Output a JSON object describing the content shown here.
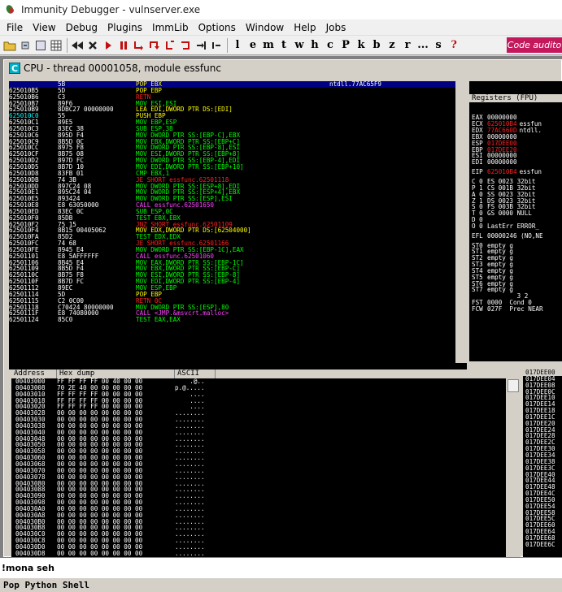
{
  "window": {
    "title": "Immunity Debugger - vulnserver.exe"
  },
  "menu": [
    "File",
    "View",
    "Debug",
    "Plugins",
    "ImmLib",
    "Options",
    "Window",
    "Help",
    "Jobs"
  ],
  "toolbar": {
    "letters": [
      "l",
      "e",
      "m",
      "t",
      "w",
      "h",
      "c",
      "P",
      "k",
      "b",
      "z",
      "r",
      "...",
      "s",
      "?"
    ],
    "code_auditor_label": "Code audito"
  },
  "cpu": {
    "caption": "CPU - thread 00001058, module essfunc",
    "icon_letter": "C",
    "disasm": [
      {
        "addr": "625010B4",
        "hex": "5B",
        "instr": "POP EBX",
        "color": "yellow",
        "cmt": "ntdll.77AC65F9",
        "sel": true
      },
      {
        "addr": "625010B5",
        "hex": "5D",
        "instr": "POP EBP",
        "color": "yellow",
        "cmt": ""
      },
      {
        "addr": "625010B6",
        "hex": "C3",
        "instr": "RETN",
        "color": "red",
        "cmt": ""
      },
      {
        "addr": "625010B7",
        "hex": "89F6",
        "instr": "MOV ESI,ESI",
        "color": "green",
        "cmt": ""
      },
      {
        "addr": "625010B9",
        "hex": "8DBC27 00000000",
        "instr": "LEA EDI,DWORD PTR DS:[EDI]",
        "color": "yellow",
        "cmt": ""
      },
      {
        "addr": "625010C0",
        "hex": "55",
        "instr": "PUSH EBP",
        "color": "yellow",
        "cmt": "",
        "cyanaddr": true
      },
      {
        "addr": "625010C1",
        "hex": "89E5",
        "instr": "MOV EBP,ESP",
        "color": "green",
        "cmt": ""
      },
      {
        "addr": "625010C3",
        "hex": "83EC 38",
        "instr": "SUB ESP,38",
        "color": "green",
        "cmt": ""
      },
      {
        "addr": "625010C6",
        "hex": "895D F4",
        "instr": "MOV DWORD PTR SS:[EBP-C],EBX",
        "color": "green",
        "cmt": ""
      },
      {
        "addr": "625010C9",
        "hex": "8B5D 0C",
        "instr": "MOV EBX,DWORD PTR SS:[EBP+C]",
        "color": "green",
        "cmt": ""
      },
      {
        "addr": "625010CC",
        "hex": "8975 F8",
        "instr": "MOV DWORD PTR SS:[EBP-8],ESI",
        "color": "green",
        "cmt": ""
      },
      {
        "addr": "625010CF",
        "hex": "8B75 08",
        "instr": "MOV ESI,DWORD PTR SS:[EBP+8]",
        "color": "green",
        "cmt": ""
      },
      {
        "addr": "625010D2",
        "hex": "897D FC",
        "instr": "MOV DWORD PTR SS:[EBP-4],EDI",
        "color": "green",
        "cmt": ""
      },
      {
        "addr": "625010D5",
        "hex": "8B7D 10",
        "instr": "MOV EDI,DWORD PTR SS:[EBP+10]",
        "color": "green",
        "cmt": ""
      },
      {
        "addr": "625010D8",
        "hex": "83FB 01",
        "instr": "CMP EBX,1",
        "color": "green",
        "cmt": ""
      },
      {
        "addr": "625010DB",
        "hex": "74 3B",
        "instr": "JE SHORT essfunc.62501118",
        "color": "red",
        "cmt": ""
      },
      {
        "addr": "625010DD",
        "hex": "897C24 08",
        "instr": "MOV DWORD PTR SS:[ESP+8],EDI",
        "color": "green",
        "cmt": ""
      },
      {
        "addr": "625010E1",
        "hex": "895C24 04",
        "instr": "MOV DWORD PTR SS:[ESP+4],EBX",
        "color": "green",
        "cmt": ""
      },
      {
        "addr": "625010E5",
        "hex": "893424",
        "instr": "MOV DWORD PTR SS:[ESP],ESI",
        "color": "green",
        "cmt": ""
      },
      {
        "addr": "625010E8",
        "hex": "E8 63050000",
        "instr": "CALL essfunc.62501650",
        "color": "magenta",
        "cmt": ""
      },
      {
        "addr": "625010ED",
        "hex": "83EC 0C",
        "instr": "SUB ESP,0C",
        "color": "green",
        "cmt": ""
      },
      {
        "addr": "625010F0",
        "hex": "85DB",
        "instr": "TEST EBX,EBX",
        "color": "green",
        "cmt": ""
      },
      {
        "addr": "625010F2",
        "hex": "75 15",
        "instr": "JNZ SHORT essfunc.62501109",
        "color": "red",
        "cmt": ""
      },
      {
        "addr": "625010F4",
        "hex": "8B15 00405062",
        "instr": "MOV EDX,DWORD PTR DS:[62504000]",
        "color": "yellow",
        "cmt": ""
      },
      {
        "addr": "625010FA",
        "hex": "85D2",
        "instr": "TEST EDX,EDX",
        "color": "green",
        "cmt": ""
      },
      {
        "addr": "625010FC",
        "hex": "74 68",
        "instr": "JE SHORT essfunc.62501166",
        "color": "red",
        "cmt": ""
      },
      {
        "addr": "625010FE",
        "hex": "8945 E4",
        "instr": "MOV DWORD PTR SS:[EBP-1C],EAX",
        "color": "green",
        "cmt": ""
      },
      {
        "addr": "62501101",
        "hex": "E8 5AFFFFFF",
        "instr": "CALL essfunc.62501060",
        "color": "magenta",
        "cmt": ""
      },
      {
        "addr": "62501106",
        "hex": "8B45 E4",
        "instr": "MOV EAX,DWORD PTR SS:[EBP-1C]",
        "color": "green",
        "cmt": ""
      },
      {
        "addr": "62501109",
        "hex": "8B5D F4",
        "instr": "MOV EBX,DWORD PTR SS:[EBP-C]",
        "color": "green",
        "cmt": ""
      },
      {
        "addr": "6250110C",
        "hex": "8B75 F8",
        "instr": "MOV ESI,DWORD PTR SS:[EBP-8]",
        "color": "green",
        "cmt": ""
      },
      {
        "addr": "6250110F",
        "hex": "8B7D FC",
        "instr": "MOV EDI,DWORD PTR SS:[EBP-4]",
        "color": "green",
        "cmt": ""
      },
      {
        "addr": "62501112",
        "hex": "89EC",
        "instr": "MOV ESP,EBP",
        "color": "green",
        "cmt": ""
      },
      {
        "addr": "62501114",
        "hex": "5D",
        "instr": "POP EBP",
        "color": "yellow",
        "cmt": ""
      },
      {
        "addr": "62501115",
        "hex": "C2 0C00",
        "instr": "RETN 0C",
        "color": "red",
        "cmt": ""
      },
      {
        "addr": "62501118",
        "hex": "C70424 80000000",
        "instr": "MOV DWORD PTR SS:[ESP],80",
        "color": "green",
        "cmt": ""
      },
      {
        "addr": "6250111F",
        "hex": "E8 74080000",
        "instr": "CALL <JMP.&msvcrt.malloc>",
        "color": "magenta",
        "cmt": ""
      },
      {
        "addr": "62501124",
        "hex": "85C0",
        "instr": "TEST EAX,EAX",
        "color": "green",
        "cmt": ""
      }
    ],
    "registers_header": "Registers (FPU)",
    "registers": [
      {
        "name": "EAX",
        "val": "00000000",
        "note": "",
        "style": ""
      },
      {
        "name": "ECX",
        "val": "625010B4",
        "note": "essfun",
        "style": "chg"
      },
      {
        "name": "EDX",
        "val": "77AC660D",
        "note": "ntdll.",
        "style": "chg"
      },
      {
        "name": "EBX",
        "val": "00000000",
        "note": "",
        "style": ""
      },
      {
        "name": "ESP",
        "val": "017DEE00",
        "note": "",
        "style": "chg"
      },
      {
        "name": "EBP",
        "val": "017DEE20",
        "note": "",
        "style": "chg"
      },
      {
        "name": "ESI",
        "val": "00000000",
        "note": "",
        "style": ""
      },
      {
        "name": "EDI",
        "val": "00000000",
        "note": "",
        "style": ""
      },
      {
        "gap": true
      },
      {
        "name": "EIP",
        "val": "625010B4",
        "note": "essfun",
        "style": "chg"
      },
      {
        "gap": true
      },
      {
        "name": "C 0",
        "val": "ES 0023 32bit",
        "note": "",
        "style": ""
      },
      {
        "name": "P 1",
        "val": "CS 001B 32bit",
        "note": "",
        "style": ""
      },
      {
        "name": "A 0",
        "val": "SS 0023 32bit",
        "note": "",
        "style": ""
      },
      {
        "name": "Z 1",
        "val": "DS 0023 32bit",
        "note": "",
        "style": ""
      },
      {
        "name": "S 0",
        "val": "FS 003B 32bit",
        "note": "",
        "style": ""
      },
      {
        "name": "T 0",
        "val": "GS 0000 NULL",
        "note": "",
        "style": ""
      },
      {
        "name": "D 0",
        "val": "",
        "note": "",
        "style": ""
      },
      {
        "name": "O 0",
        "val": "LastErr ERROR_",
        "note": "",
        "style": ""
      },
      {
        "gap": true
      },
      {
        "name": "EFL",
        "val": "00000246 (NO,NE",
        "note": "",
        "style": ""
      },
      {
        "gap": true
      },
      {
        "name": "ST0",
        "val": "empty g",
        "note": "",
        "style": ""
      },
      {
        "name": "ST1",
        "val": "empty g",
        "note": "",
        "style": ""
      },
      {
        "name": "ST2",
        "val": "empty g",
        "note": "",
        "style": ""
      },
      {
        "name": "ST3",
        "val": "empty g",
        "note": "",
        "style": ""
      },
      {
        "name": "ST4",
        "val": "empty g",
        "note": "",
        "style": ""
      },
      {
        "name": "ST5",
        "val": "empty g",
        "note": "",
        "style": ""
      },
      {
        "name": "ST6",
        "val": "empty g",
        "note": "",
        "style": ""
      },
      {
        "name": "ST7",
        "val": "empty g",
        "note": "",
        "style": ""
      },
      {
        "name": "",
        "val": "        3 2",
        "note": "",
        "style": ""
      },
      {
        "name": "FST",
        "val": "0000  Cond 0",
        "note": "",
        "style": ""
      },
      {
        "name": "FCW",
        "val": "027F  Prec NEAR",
        "note": "",
        "style": ""
      }
    ],
    "dump_columns": [
      "Address",
      "Hex dump",
      "ASCII"
    ],
    "dump": [
      {
        "addr": "00403000",
        "hex": "FF FF FF FF 00 40 00 00",
        "ascii": "    .@.."
      },
      {
        "addr": "00403008",
        "hex": "70 2E 40 00 00 00 00 00",
        "ascii": "p.@....."
      },
      {
        "addr": "00403010",
        "hex": "FF FF FF FF 00 00 00 00",
        "ascii": "    ...."
      },
      {
        "addr": "00403018",
        "hex": "FF FF FF FF 00 00 00 00",
        "ascii": "    ...."
      },
      {
        "addr": "00403020",
        "hex": "FF FF FF FF 00 00 00 00",
        "ascii": "    ...."
      },
      {
        "addr": "00403028",
        "hex": "00 00 00 00 00 00 00 00",
        "ascii": "........"
      },
      {
        "addr": "00403030",
        "hex": "00 00 00 00 00 00 00 00",
        "ascii": "........"
      },
      {
        "addr": "00403038",
        "hex": "00 00 00 00 00 00 00 00",
        "ascii": "........"
      },
      {
        "addr": "00403040",
        "hex": "00 00 00 00 00 00 00 00",
        "ascii": "........"
      },
      {
        "addr": "00403048",
        "hex": "00 00 00 00 00 00 00 00",
        "ascii": "........"
      },
      {
        "addr": "00403050",
        "hex": "00 00 00 00 00 00 00 00",
        "ascii": "........"
      },
      {
        "addr": "00403058",
        "hex": "00 00 00 00 00 00 00 00",
        "ascii": "........"
      },
      {
        "addr": "00403060",
        "hex": "00 00 00 00 00 00 00 00",
        "ascii": "........"
      },
      {
        "addr": "00403068",
        "hex": "00 00 00 00 00 00 00 00",
        "ascii": "........"
      },
      {
        "addr": "00403070",
        "hex": "00 00 00 00 00 00 00 00",
        "ascii": "........"
      },
      {
        "addr": "00403078",
        "hex": "00 00 00 00 00 00 00 00",
        "ascii": "........"
      },
      {
        "addr": "00403080",
        "hex": "00 00 00 00 00 00 00 00",
        "ascii": "........"
      },
      {
        "addr": "00403088",
        "hex": "00 00 00 00 00 00 00 00",
        "ascii": "........"
      },
      {
        "addr": "00403090",
        "hex": "00 00 00 00 00 00 00 00",
        "ascii": "........"
      },
      {
        "addr": "00403098",
        "hex": "00 00 00 00 00 00 00 00",
        "ascii": "........"
      },
      {
        "addr": "004030A0",
        "hex": "00 00 00 00 00 00 00 00",
        "ascii": "........"
      },
      {
        "addr": "004030A8",
        "hex": "00 00 00 00 00 00 00 00",
        "ascii": "........"
      },
      {
        "addr": "004030B0",
        "hex": "00 00 00 00 00 00 00 00",
        "ascii": "........"
      },
      {
        "addr": "004030B8",
        "hex": "00 00 00 00 00 00 00 00",
        "ascii": "........"
      },
      {
        "addr": "004030C0",
        "hex": "00 00 00 00 00 00 00 00",
        "ascii": "........"
      },
      {
        "addr": "004030C8",
        "hex": "00 00 00 00 00 00 00 00",
        "ascii": "........"
      },
      {
        "addr": "004030D0",
        "hex": "00 00 00 00 00 00 00 00",
        "ascii": "........"
      },
      {
        "addr": "004030D8",
        "hex": "00 00 00 00 00 00 00 00",
        "ascii": "........"
      }
    ],
    "stack": [
      "017DEE00",
      "017DEE04",
      "017DEE08",
      "017DEE0C",
      "017DEE10",
      "017DEE14",
      "017DEE18",
      "017DEE1C",
      "017DEE20",
      "017DEE24",
      "017DEE28",
      "017DEE2C",
      "017DEE30",
      "017DEE34",
      "017DEE38",
      "017DEE3C",
      "017DEE40",
      "017DEE44",
      "017DEE48",
      "017DEE4C",
      "017DEE50",
      "017DEE54",
      "017DEE58",
      "017DEE5C",
      "017DEE60",
      "017DEE64",
      "017DEE68",
      "017DEE6C"
    ]
  },
  "command": {
    "value": "!mona seh"
  },
  "status": {
    "text": "Pop Python Shell"
  }
}
